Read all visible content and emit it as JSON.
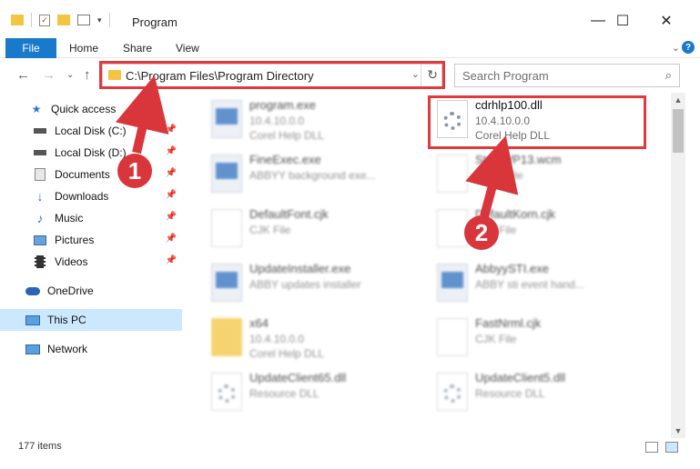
{
  "window": {
    "title": "Program",
    "minimize": "—",
    "maximize": "☐",
    "close": "✕"
  },
  "ribbon": {
    "file": "File",
    "home": "Home",
    "share": "Share",
    "view": "View",
    "expand": "⌄",
    "help": "?"
  },
  "nav": {
    "back": "←",
    "forward": "→",
    "recent": "⌄",
    "up": "↑",
    "address": "C:\\Program Files\\Program Directory",
    "dropdown": "⌄",
    "refresh": "↻",
    "search_placeholder": "Search Program",
    "search_icon": "⌕"
  },
  "sidebar": {
    "items": [
      {
        "label": "Quick access",
        "icon": "star-icon"
      },
      {
        "label": "Local Disk (C:)",
        "icon": "drive-icon"
      },
      {
        "label": "Local Disk (D:)",
        "icon": "drive-icon"
      },
      {
        "label": "Documents",
        "icon": "documents-icon"
      },
      {
        "label": "Downloads",
        "icon": "download-icon"
      },
      {
        "label": "Music",
        "icon": "music-icon"
      },
      {
        "label": "Pictures",
        "icon": "pictures-icon"
      },
      {
        "label": "Videos",
        "icon": "videos-icon"
      },
      {
        "label": "OneDrive",
        "icon": "cloud-icon"
      },
      {
        "label": "This PC",
        "icon": "pc-icon"
      },
      {
        "label": "Network",
        "icon": "network-icon"
      }
    ]
  },
  "files": [
    {
      "name": "program.exe",
      "l2": "10.4.10.0.0",
      "l3": "Corel Help DLL"
    },
    {
      "name": "cdrhlp100.dll",
      "l2": "10.4.10.0.0",
      "l3": "Corel Help DLL"
    },
    {
      "name": "FineExec.exe",
      "l2": "ABBYY background exe...",
      "l3": ""
    },
    {
      "name": "StyleWP13.wcm",
      "l2": "WCM File",
      "l3": ""
    },
    {
      "name": "DefaultFont.cjk",
      "l2": "CJK File",
      "l3": ""
    },
    {
      "name": "DefaultKorn.cjk",
      "l2": "CJK File",
      "l3": ""
    },
    {
      "name": "UpdateInstaller.exe",
      "l2": "ABBY updates installer",
      "l3": ""
    },
    {
      "name": "AbbyySTI.exe",
      "l2": "ABBY sti event hand...",
      "l3": ""
    },
    {
      "name": "x64",
      "l2": "10.4.10.0.0",
      "l3": "Corel Help DLL"
    },
    {
      "name": "FastNrml.cjk",
      "l2": "CJK File",
      "l3": ""
    },
    {
      "name": "UpdateClient65.dll",
      "l2": "Resource DLL",
      "l3": ""
    },
    {
      "name": "UpdateClient5.dll",
      "l2": "Resource DLL",
      "l3": ""
    }
  ],
  "status": {
    "count": "177 items"
  },
  "callouts": {
    "one": "1",
    "two": "2"
  },
  "colors": {
    "accent": "#1979ca",
    "highlight": "#e0393e",
    "selected": "#cce8ff"
  }
}
